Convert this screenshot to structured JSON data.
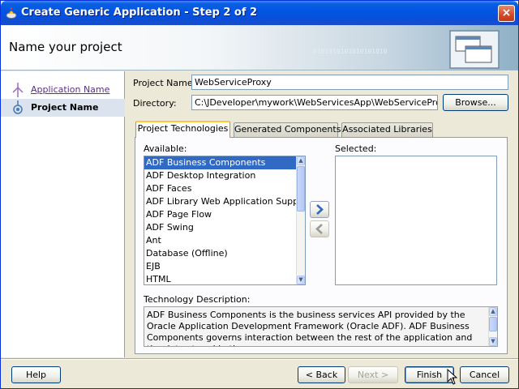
{
  "window": {
    "title": "Create Generic Application - Step 2 of 2",
    "close_glyph": "×"
  },
  "header": {
    "title": "Name your project",
    "decoration": "0101010101010101010"
  },
  "nav": {
    "items": [
      {
        "label": "Application Name",
        "state": "visited",
        "icon": "wizard-step-icon"
      },
      {
        "label": "Project Name",
        "state": "current",
        "icon": "wizard-step-icon"
      }
    ]
  },
  "form": {
    "project_name_label": "Project Name:",
    "project_name_value": "WebServiceProxy",
    "directory_label": "Directory:",
    "directory_value": "C:\\JDeveloper\\mywork\\WebServicesApp\\WebServiceProxy",
    "browse_label": "Browse..."
  },
  "tabs": [
    {
      "label": "Project Technologies",
      "active": true
    },
    {
      "label": "Generated Components",
      "active": false
    },
    {
      "label": "Associated Libraries",
      "active": false
    }
  ],
  "technologies": {
    "available_label": "Available:",
    "selected_label": "Selected:",
    "available": [
      "ADF Business Components",
      "ADF Desktop Integration",
      "ADF Faces",
      "ADF Library Web Application Support",
      "ADF Page Flow",
      "ADF Swing",
      "Ant",
      "Database (Offline)",
      "EJB",
      "HTML"
    ],
    "selected_index": 0,
    "selected": [],
    "add_icon": "arrow-right-icon",
    "remove_icon": "arrow-left-icon",
    "description_label": "Technology Description:",
    "description": "ADF Business Components is the business services API provided by the Oracle Application Development Framework (Oracle ADF).  ADF Business Components governs interaction between the rest of the application and the data stored in the"
  },
  "footer": {
    "help": "Help",
    "back": "< Back",
    "next": "Next >",
    "finish": "Finish",
    "cancel": "Cancel"
  },
  "colors": {
    "titlebar": "#0054e3",
    "selection": "#316ac5",
    "tab_accent": "#ffc83c"
  }
}
